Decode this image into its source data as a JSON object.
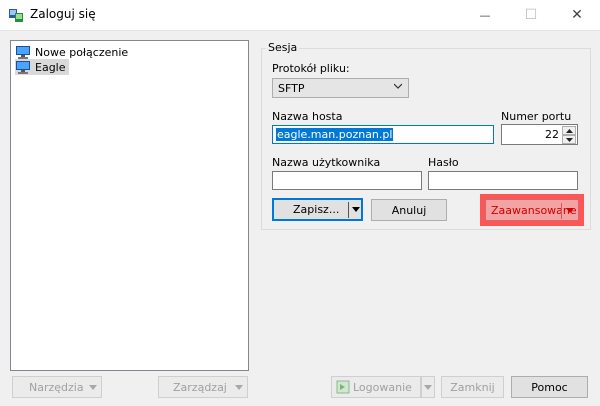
{
  "window": {
    "title": "Zaloguj się",
    "minimize_glyph": "—",
    "maximize_glyph": "☐",
    "close_glyph": "✕"
  },
  "tree": {
    "items": [
      {
        "label": "Nowe połączenie",
        "icon": "computer-icon",
        "selected": false
      },
      {
        "label": "Eagle",
        "icon": "computer-icon",
        "selected": true
      }
    ]
  },
  "session": {
    "group_label": "Sesja",
    "protocol_label": "Protokół pliku:",
    "protocol_value": "SFTP",
    "host_label": "Nazwa hosta",
    "host_value": "eagle.man.poznan.pl",
    "port_label": "Numer portu",
    "port_value": "22",
    "user_label": "Nazwa użytkownika",
    "user_value": "",
    "password_label": "Hasło",
    "password_value": ""
  },
  "actions": {
    "save_label": "Zapisz...",
    "cancel_label": "Anuluj",
    "advanced_label": "Zaawansowane",
    "highlight_color": "#ff3b3b"
  },
  "footer": {
    "tools_label": "Narzędzia",
    "manage_label": "Zarządzaj",
    "login_label": "Logowanie",
    "close_label": "Zamknij",
    "help_label": "Pomoc"
  },
  "colors": {
    "accent": "#0078d7",
    "selection": "#d9d9d9"
  }
}
